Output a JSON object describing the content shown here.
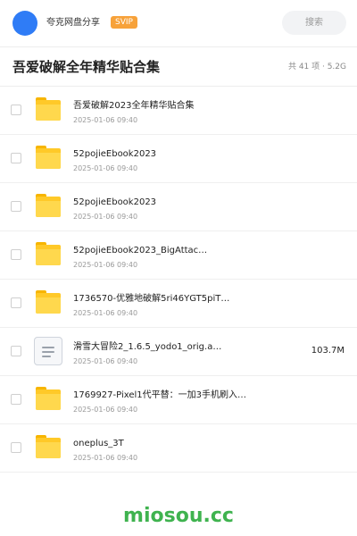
{
  "header": {
    "app_name": "夸克网盘分享",
    "badge": "SVIP",
    "search_placeholder": "搜索"
  },
  "folder": {
    "title": "吾爱破解全年精华贴合集",
    "summary": "共 41 项 · 5.2G"
  },
  "items": [
    {
      "type": "folder",
      "name": "吾爱破解2023全年精华贴合集",
      "date": "2025-01-06 09:40",
      "size": ""
    },
    {
      "type": "folder",
      "name": "52pojieEbook2023",
      "date": "2025-01-06 09:40",
      "size": ""
    },
    {
      "type": "folder",
      "name": "52pojieEbook2023",
      "date": "2025-01-06 09:40",
      "size": ""
    },
    {
      "type": "folder",
      "name": "52pojieEbook2023_BigAttac…",
      "date": "2025-01-06 09:40",
      "size": ""
    },
    {
      "type": "folder",
      "name": "1736570-优雅地破解5ri46YGT5piT…",
      "date": "2025-01-06 09:40",
      "size": ""
    },
    {
      "type": "file",
      "name": "滑雪大冒险2_1.6.5_yodo1_orig.a…",
      "date": "2025-01-06 09:40",
      "size": "103.7M"
    },
    {
      "type": "folder",
      "name": "1769927-Pixel1代平替：一加3手机刷入…",
      "date": "2025-01-06 09:40",
      "size": ""
    },
    {
      "type": "folder",
      "name": "oneplus_3T",
      "date": "2025-01-06 09:40",
      "size": ""
    }
  ],
  "watermark": "miosou.cc",
  "colors": {
    "accent": "#2f7cf6",
    "badge": "#f7a23a",
    "folder": "#ffc928",
    "watermark": "#3fb34f"
  }
}
